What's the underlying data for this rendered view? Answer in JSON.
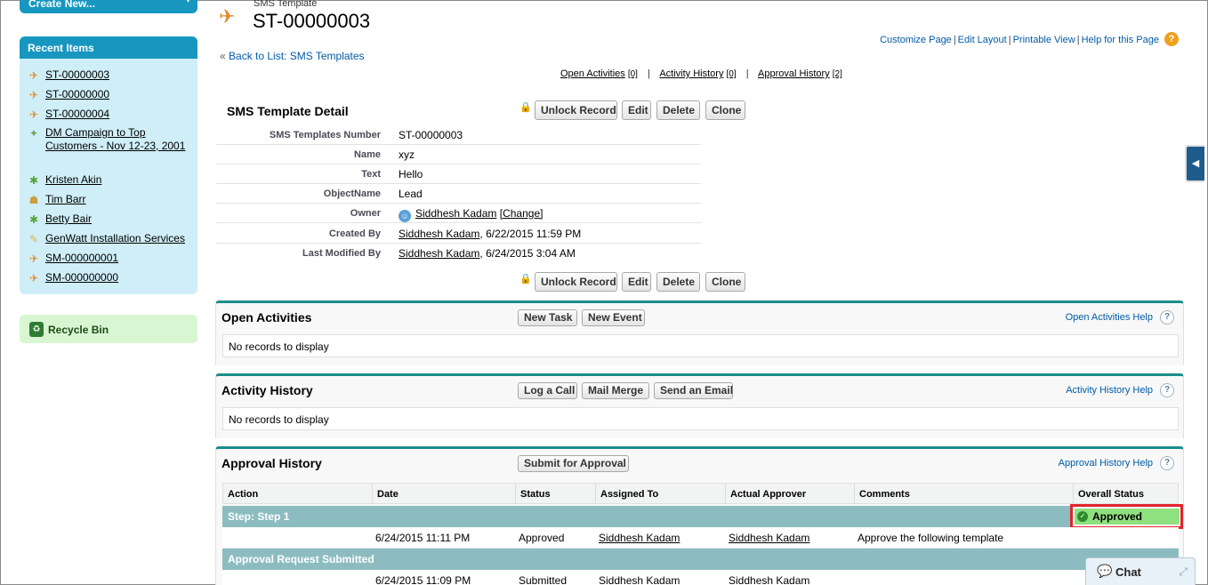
{
  "sidebar": {
    "create_new": "Create New...",
    "recent_title": "Recent Items",
    "recent_items": [
      {
        "label": "ST-00000003",
        "icon": "sms-template-icon"
      },
      {
        "label": "ST-00000000",
        "icon": "sms-template-icon"
      },
      {
        "label": "ST-00000004",
        "icon": "sms-template-icon"
      },
      {
        "label": "DM Campaign to Top Customers - Nov 12-23, 2001",
        "icon": "campaign-icon"
      },
      {
        "label": "Kristen Akin",
        "icon": "contact-icon"
      },
      {
        "label": "Tim Barr",
        "icon": "lead-icon"
      },
      {
        "label": "Betty Bair",
        "icon": "contact-icon"
      },
      {
        "label": "GenWatt Installation Services",
        "icon": "opportunity-icon"
      },
      {
        "label": "SM-000000001",
        "icon": "sms-template-icon"
      },
      {
        "label": "SM-000000000",
        "icon": "sms-template-icon"
      }
    ],
    "recycle_bin": "Recycle Bin"
  },
  "header": {
    "object_type": "SMS Template",
    "title": "ST-00000003",
    "top_links": [
      "Customize Page",
      "Edit Layout",
      "Printable View",
      "Help for this Page"
    ],
    "back_link": "Back to List: SMS Templates",
    "related_links": [
      {
        "label": "Open Activities",
        "count": "[0]"
      },
      {
        "label": "Activity History",
        "count": "[0]"
      },
      {
        "label": "Approval History",
        "count": "[2]"
      }
    ]
  },
  "detail": {
    "title": "SMS Template Detail",
    "buttons": [
      "Unlock Record",
      "Edit",
      "Delete",
      "Clone"
    ],
    "fields": [
      {
        "label": "SMS Templates Number",
        "value": "ST-00000003"
      },
      {
        "label": "Name",
        "value": "xyz"
      },
      {
        "label": "Text",
        "value": "Hello"
      },
      {
        "label": "ObjectName",
        "value": "Lead"
      },
      {
        "label": "Owner",
        "value": "Siddhesh Kadam",
        "extra": "[Change]"
      },
      {
        "label": "Created By",
        "value": "Siddhesh Kadam",
        "extra": ", 6/22/2015 11:59 PM"
      },
      {
        "label": "Last Modified By",
        "value": "Siddhesh Kadam",
        "extra": ", 6/24/2015 3:04 AM"
      }
    ]
  },
  "open_activities": {
    "title": "Open Activities",
    "buttons": [
      "New Task",
      "New Event"
    ],
    "help": "Open Activities Help",
    "empty": "No records to display"
  },
  "activity_history": {
    "title": "Activity History",
    "buttons": [
      "Log a Call",
      "Mail Merge",
      "Send an Email"
    ],
    "help": "Activity History Help",
    "empty": "No records to display"
  },
  "approval_history": {
    "title": "Approval History",
    "button": "Submit for Approval",
    "help": "Approval History Help",
    "columns": [
      "Action",
      "Date",
      "Status",
      "Assigned To",
      "Actual Approver",
      "Comments",
      "Overall Status"
    ],
    "step1": "Step: Step 1",
    "overall_status": "Approved",
    "row1": {
      "date": "6/24/2015 11:11 PM",
      "status": "Approved",
      "assigned": "Siddhesh Kadam",
      "approver": "Siddhesh Kadam",
      "comments": "Approve the following template"
    },
    "step2": "Approval Request Submitted",
    "row2": {
      "date": "6/24/2015 11:09 PM",
      "status": "Submitted",
      "assigned": "Siddhesh Kadam",
      "approver": "Siddhesh Kadam",
      "comments": ""
    }
  },
  "chat": {
    "label": "Chat"
  },
  "colors": {
    "accent": "#1797c0",
    "related_border": "#1b8d8b",
    "approved": "#8fe07e",
    "highlight": "#e0242c"
  }
}
